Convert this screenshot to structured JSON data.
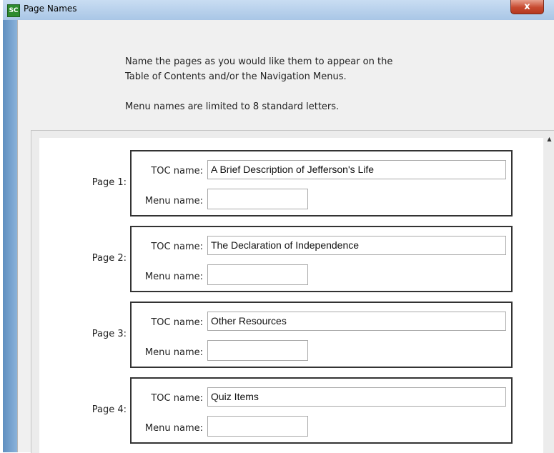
{
  "window": {
    "icon_text": "SC",
    "title": "Page Names",
    "close_label": "x"
  },
  "intro": {
    "line1": "Name the pages as you would like them to appear on the",
    "line2": "Table of Contents and/or the Navigation Menus.",
    "line3": "Menu names are limited to 8 standard letters."
  },
  "field_labels": {
    "toc": "TOC name:",
    "menu": "Menu name:"
  },
  "pages": [
    {
      "label": "Page 1:",
      "toc_name": "A Brief Description of Jefferson's Life",
      "menu_name": ""
    },
    {
      "label": "Page 2:",
      "toc_name": "The Declaration of Independence",
      "menu_name": ""
    },
    {
      "label": "Page 3:",
      "toc_name": "Other Resources",
      "menu_name": ""
    },
    {
      "label": "Page 4:",
      "toc_name": "Quiz Items",
      "menu_name": ""
    }
  ],
  "scrollbar": {
    "up_arrow": "▲"
  }
}
